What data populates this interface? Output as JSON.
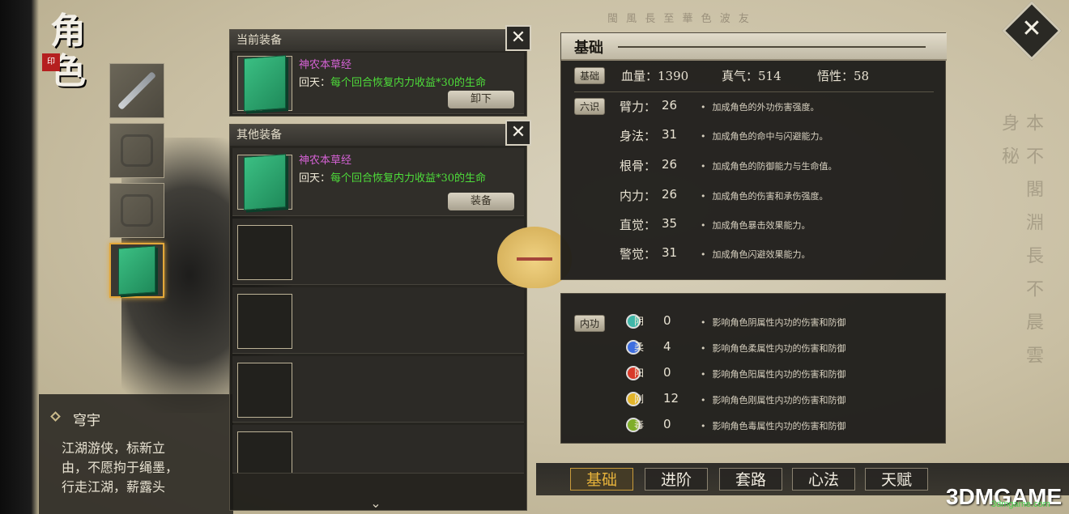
{
  "screen": {
    "title": "角色",
    "bg_script_top": "閩 風 長 至 華 色 波 友",
    "bg_script_right": "本 不 閣 淵 長 不 晨 雲 身 秘"
  },
  "side_slots": [
    "weapon",
    "armor",
    "accessory",
    "book"
  ],
  "bio": {
    "name": "穹宇",
    "lines": [
      "江湖游侠，标新立",
      "由，不愿拘于绳墨，",
      "行走江湖，薪露头"
    ]
  },
  "current_equipment": {
    "header": "当前装备",
    "close": "✕",
    "item": {
      "name": "神农本草经",
      "effect_label": "回天：",
      "effect_desc": "每个回合恢复内力收益*30的生命",
      "action": "卸下"
    }
  },
  "other_equipment": {
    "header": "其他装备",
    "close": "✕",
    "item": {
      "name": "神农本草经",
      "effect_label": "回天：",
      "effect_desc": "每个回合恢复内力收益*30的生命",
      "action": "装备"
    },
    "empty_slots": 4,
    "scroll_hint": "⌄"
  },
  "stats": {
    "title": "基础",
    "base_tag": "基础",
    "base": [
      {
        "label": "血量：",
        "value": "1390"
      },
      {
        "label": "真气：",
        "value": "514"
      },
      {
        "label": "悟性：",
        "value": "58"
      }
    ],
    "six_tag": "六识",
    "attributes": [
      {
        "label": "臂力：",
        "value": "26",
        "desc": "加成角色的外功伤害强度。"
      },
      {
        "label": "身法：",
        "value": "31",
        "desc": "加成角色的命中与闪避能力。"
      },
      {
        "label": "根骨：",
        "value": "26",
        "desc": "加成角色的防御能力与生命值。"
      },
      {
        "label": "内力：",
        "value": "26",
        "desc": "加成角色的伤害和承伤强度。"
      },
      {
        "label": "直觉：",
        "value": "35",
        "desc": "加成角色暴击效果能力。"
      },
      {
        "label": "警觉：",
        "value": "31",
        "desc": "加成角色闪避效果能力。"
      }
    ]
  },
  "neigong": {
    "tag": "内功",
    "rows": [
      {
        "char": "阴",
        "value": "0",
        "color": "#3fb6a8",
        "desc": "影响角色阴属性内功的伤害和防御"
      },
      {
        "char": "柔",
        "value": "4",
        "color": "#3e6ee0",
        "desc": "影响角色柔属性内功的伤害和防御"
      },
      {
        "char": "阳",
        "value": "0",
        "color": "#d83a2a",
        "desc": "影响角色阳属性内功的伤害和防御"
      },
      {
        "char": "刚",
        "value": "12",
        "color": "#e2b42a",
        "desc": "影响角色刚属性内功的伤害和防御"
      },
      {
        "char": "毒",
        "value": "0",
        "color": "#7fae2a",
        "desc": "影响角色毒属性内功的伤害和防御"
      }
    ]
  },
  "tabs": [
    {
      "label": "基础",
      "active": true
    },
    {
      "label": "进阶",
      "active": false
    },
    {
      "label": "套路",
      "active": false
    },
    {
      "label": "心法",
      "active": false
    },
    {
      "label": "天赋",
      "active": false
    }
  ],
  "exit": "✕",
  "watermark": "3DMGAME",
  "watermark_sub": "3dmgame.com"
}
